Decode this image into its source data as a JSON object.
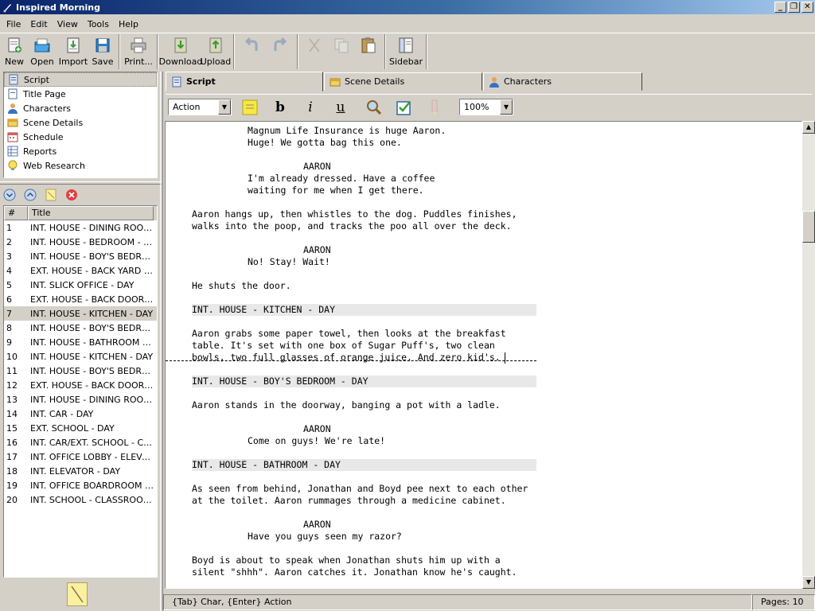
{
  "window": {
    "title": "Inspired Morning",
    "buttons": [
      "_",
      "❐",
      "✕"
    ]
  },
  "menu": [
    "File",
    "Edit",
    "View",
    "Tools",
    "Help"
  ],
  "toolbar": {
    "new": "New",
    "open": "Open",
    "import": "Import",
    "save": "Save",
    "print": "Print...",
    "download": "Download",
    "upload": "Upload",
    "sidebar": "Sidebar"
  },
  "nav": {
    "items": [
      {
        "label": "Script",
        "icon": "script-icon"
      },
      {
        "label": "Title Page",
        "icon": "title-page-icon"
      },
      {
        "label": "Characters",
        "icon": "characters-icon"
      },
      {
        "label": "Scene Details",
        "icon": "scene-details-icon"
      },
      {
        "label": "Schedule",
        "icon": "schedule-icon"
      },
      {
        "label": "Reports",
        "icon": "reports-icon"
      },
      {
        "label": "Web Research",
        "icon": "web-research-icon"
      }
    ],
    "selected": "Script"
  },
  "scene_list": {
    "headers": {
      "num": "#",
      "title": "Title"
    },
    "selected": 7,
    "rows": [
      {
        "num": "1",
        "title": "INT. HOUSE - DINING ROOM - DAY"
      },
      {
        "num": "2",
        "title": "INT. HOUSE - BEDROOM - DAY"
      },
      {
        "num": "3",
        "title": "INT. HOUSE - BOY'S BEDROOM - DAY"
      },
      {
        "num": "4",
        "title": "EXT. HOUSE - BACK YARD - DAY"
      },
      {
        "num": "5",
        "title": "INT. SLICK OFFICE - DAY"
      },
      {
        "num": "6",
        "title": "EXT. HOUSE - BACK DOOR - DAY"
      },
      {
        "num": "7",
        "title": "INT. HOUSE - KITCHEN - DAY"
      },
      {
        "num": "8",
        "title": "INT. HOUSE - BOY'S BEDROOM - DAY"
      },
      {
        "num": "9",
        "title": "INT. HOUSE - BATHROOM - DAY"
      },
      {
        "num": "10",
        "title": "INT. HOUSE - KITCHEN - DAY"
      },
      {
        "num": "11",
        "title": "INT. HOUSE - BOY'S BEDROOM - DAY"
      },
      {
        "num": "12",
        "title": "EXT. HOUSE - BACK DOOR - DAY"
      },
      {
        "num": "13",
        "title": "INT. HOUSE - DINING ROOM - DAY"
      },
      {
        "num": "14",
        "title": "INT. CAR - DAY"
      },
      {
        "num": "15",
        "title": "EXT. SCHOOL - DAY"
      },
      {
        "num": "16",
        "title": "INT. CAR/EXT. SCHOOL - CONTINUOUS"
      },
      {
        "num": "17",
        "title": "INT. OFFICE LOBBY - ELEVATOR - DAY"
      },
      {
        "num": "18",
        "title": "INT. ELEVATOR - DAY"
      },
      {
        "num": "19",
        "title": "INT. OFFICE BOARDROOM - DAY"
      },
      {
        "num": "20",
        "title": "INT. SCHOOL - CLASSROOM - DAY"
      }
    ]
  },
  "tabs": [
    {
      "label": "Script",
      "active": true
    },
    {
      "label": "Scene Details",
      "active": false
    },
    {
      "label": "Characters",
      "active": false
    }
  ],
  "format": {
    "element_type": "Action",
    "zoom": "100%",
    "bold": "b",
    "italic": "i",
    "underline": "u"
  },
  "script": [
    {
      "type": "dialogue",
      "text": "Magnum Life Insurance is huge Aaron."
    },
    {
      "type": "dialogue",
      "text": "Huge! We gotta bag this one."
    },
    {
      "type": "character",
      "text": "AARON"
    },
    {
      "type": "dialogue",
      "text": "I'm already dressed. Have a coffee"
    },
    {
      "type": "dialogue",
      "text": "waiting for me when I get there."
    },
    {
      "type": "action",
      "text": "Aaron hangs up, then whistles to the dog. Puddles finishes,"
    },
    {
      "type": "action",
      "text": "walks into the poop, and tracks the poo all over the deck."
    },
    {
      "type": "character",
      "text": "AARON"
    },
    {
      "type": "dialogue",
      "text": "No! Stay! Wait!"
    },
    {
      "type": "action",
      "text": "He shuts the door."
    },
    {
      "type": "heading",
      "text": "INT. HOUSE - KITCHEN - DAY"
    },
    {
      "type": "action",
      "text": "Aaron grabs some paper towel, then looks at the breakfast"
    },
    {
      "type": "action",
      "text": "table. It's set with one box of Sugar Puff's, two clean"
    },
    {
      "type": "action",
      "text": "bowls, two full glasses of orange juice. And zero kid's."
    },
    {
      "type": "heading",
      "text": "INT. HOUSE - BOY'S BEDROOM - DAY"
    },
    {
      "type": "action",
      "text": "Aaron stands in the doorway, banging a pot with a ladle."
    },
    {
      "type": "character",
      "text": "AARON"
    },
    {
      "type": "dialogue",
      "text": "Come on guys! We're late!"
    },
    {
      "type": "heading",
      "text": "INT. HOUSE - BATHROOM - DAY"
    },
    {
      "type": "action",
      "text": "As seen from behind, Jonathan and Boyd pee next to each other"
    },
    {
      "type": "action",
      "text": "at the toilet. Aaron rummages through a medicine cabinet."
    },
    {
      "type": "character",
      "text": "AARON"
    },
    {
      "type": "dialogue",
      "text": "Have you guys seen my razor?"
    },
    {
      "type": "action",
      "text": "Boyd is about to speak when Jonathan shuts him up with a"
    },
    {
      "type": "action",
      "text": "silent \"shhh\". Aaron catches it. Jonathan know he's caught."
    }
  ],
  "status": {
    "hint": "{Tab} Char, {Enter} Action",
    "pages": "Pages: 10"
  }
}
